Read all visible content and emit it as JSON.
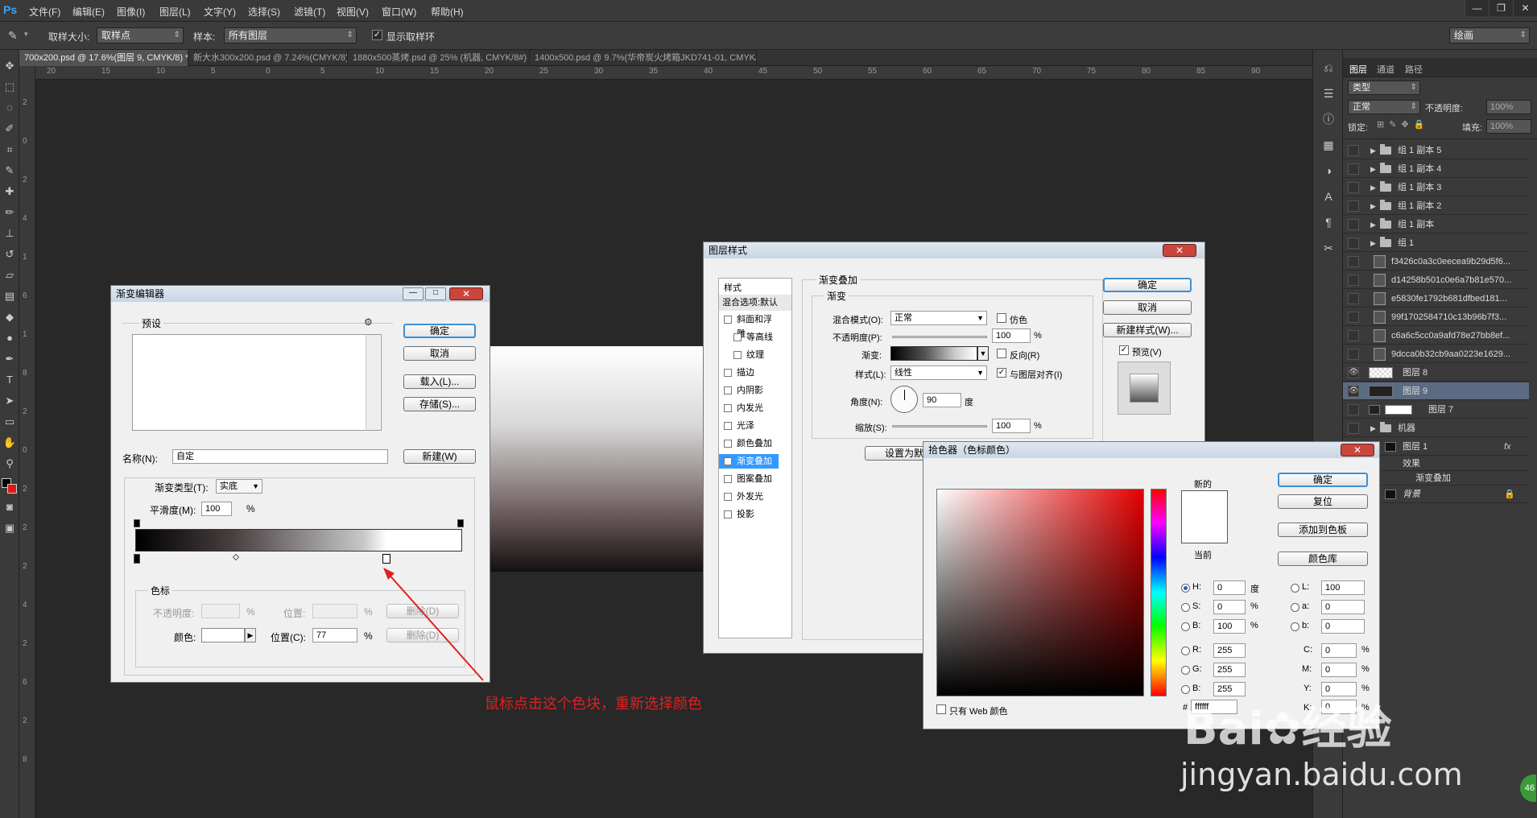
{
  "app": {
    "logo": "Ps"
  },
  "menu": [
    "文件(F)",
    "编辑(E)",
    "图像(I)",
    "图层(L)",
    "文字(Y)",
    "选择(S)",
    "滤镜(T)",
    "视图(V)",
    "窗口(W)",
    "帮助(H)"
  ],
  "window_buttons": [
    "—",
    "❐",
    "✕"
  ],
  "options": {
    "sample_size_label": "取样大小:",
    "sample_size_value": "取样点",
    "sample_label": "样本:",
    "sample_value": "所有图层",
    "show_ring_label": "显示取样环",
    "workspace": "绘画"
  },
  "tabs": [
    "700x200.psd @ 17.6%(图层 9, CMYK/8) *",
    "新大水300x200.psd @ 7.24%(CMYK/8)",
    "1880x500蒸烤.psd @ 25% (机器, CMYK/8#) *",
    "1400x500.psd @ 9.7%(华帝炭火烤箱JKD741-01, CMYK/8)"
  ],
  "hruler": [
    "20",
    "15",
    "10",
    "5",
    "0",
    "5",
    "10",
    "15",
    "20",
    "25",
    "30",
    "35",
    "40",
    "45",
    "50",
    "55",
    "60",
    "65",
    "70",
    "75",
    "80",
    "85",
    "90"
  ],
  "vruler": [
    "2",
    "0",
    "2",
    "4",
    "1",
    "6",
    "1",
    "8",
    "2",
    "0",
    "2",
    "2",
    "2",
    "4",
    "2",
    "6",
    "2",
    "8"
  ],
  "layers_panel": {
    "tabs": [
      "图层",
      "通道",
      "路径"
    ],
    "filter": "类型",
    "blend": "正常",
    "opacity_label": "不透明度:",
    "opacity_value": "100%",
    "lock_label": "锁定:",
    "fill_label": "填充:",
    "fill_value": "100%",
    "layers": [
      {
        "name": "组 1 副本 5",
        "type": "group"
      },
      {
        "name": "组 1 副本 4",
        "type": "group"
      },
      {
        "name": "组 1 副本 3",
        "type": "group"
      },
      {
        "name": "组 1 副本 2",
        "type": "group"
      },
      {
        "name": "组 1 副本",
        "type": "group"
      },
      {
        "name": "组 1",
        "type": "group"
      },
      {
        "name": "f3426c0a3c0eecea9b29d5f6...",
        "type": "smart"
      },
      {
        "name": "d14258b501c0e6a7b81e570...",
        "type": "smart"
      },
      {
        "name": "e5830fe1792b681dfbed181...",
        "type": "smart"
      },
      {
        "name": "99f1702584710c13b96b7f3...",
        "type": "smart"
      },
      {
        "name": "c6a6c5cc0a9afd78e27bb8ef...",
        "type": "smart"
      },
      {
        "name": "9dcca0b32cb9aa0223e1629...",
        "type": "smart"
      },
      {
        "name": "图层 8",
        "type": "layer8"
      },
      {
        "name": "图层 9",
        "type": "layer9"
      },
      {
        "name": "图层 7",
        "type": "layer7"
      },
      {
        "name": "机器",
        "type": "group"
      },
      {
        "name": "图层 1",
        "type": "layer1"
      },
      {
        "name": "效果",
        "type": "effects"
      },
      {
        "name": "渐变叠加",
        "type": "effect"
      },
      {
        "name": "背景",
        "type": "background"
      }
    ],
    "fx": "fx"
  },
  "gradient_editor": {
    "title": "渐变编辑器",
    "presets_label": "预设",
    "ok": "确定",
    "cancel": "取消",
    "load": "载入(L)...",
    "save": "存储(S)...",
    "name_label": "名称(N):",
    "name_value": "自定",
    "new": "新建(W)",
    "type_label": "渐变类型(T):",
    "type_value": "实底",
    "smooth_label": "平滑度(M):",
    "smooth_value": "100",
    "smooth_unit": "%",
    "stops_label": "色标",
    "opacity_label": "不透明度:",
    "pct": "%",
    "location_label": "位置:",
    "delete1": "删除(D)",
    "color_label": "颜色:",
    "location2_label": "位置(C):",
    "location2_value": "77",
    "delete2": "删除(D)"
  },
  "layer_style": {
    "title": "图层样式",
    "list_header": "样式",
    "blend_default": "混合选项:默认",
    "items": [
      {
        "label": "斜面和浮雕",
        "checked": false,
        "indent": false
      },
      {
        "label": "等高线",
        "checked": false,
        "indent": true
      },
      {
        "label": "纹理",
        "checked": false,
        "indent": true
      },
      {
        "label": "描边",
        "checked": false,
        "indent": false
      },
      {
        "label": "内阴影",
        "checked": false,
        "indent": false
      },
      {
        "label": "内发光",
        "checked": false,
        "indent": false
      },
      {
        "label": "光泽",
        "checked": false,
        "indent": false
      },
      {
        "label": "颜色叠加",
        "checked": false,
        "indent": false
      },
      {
        "label": "渐变叠加",
        "checked": true,
        "indent": false
      },
      {
        "label": "图案叠加",
        "checked": false,
        "indent": false
      },
      {
        "label": "外发光",
        "checked": false,
        "indent": false
      },
      {
        "label": "投影",
        "checked": false,
        "indent": false
      }
    ],
    "section_title": "渐变叠加",
    "sub_title": "渐变",
    "blend_label": "混合模式(O):",
    "blend_value": "正常",
    "dither": "仿色",
    "opacity_label": "不透明度(P):",
    "opacity_value": "100",
    "pct": "%",
    "gradient_label": "渐变:",
    "reverse": "反向(R)",
    "style_label": "样式(L):",
    "style_value": "线性",
    "align": "与图层对齐(I)",
    "angle_label": "角度(N):",
    "angle_value": "90",
    "angle_unit": "度",
    "scale_label": "缩放(S):",
    "scale_value": "100",
    "set_default": "设置为默认",
    "ok": "确定",
    "cancel": "取消",
    "new_style": "新建样式(W)...",
    "preview": "预览(V)"
  },
  "color_picker": {
    "title": "拾色器（色标颜色）",
    "new_label": "新的",
    "current_label": "当前",
    "ok": "确定",
    "reset": "复位",
    "add_swatch": "添加到色板",
    "libraries": "颜色库",
    "H": "0",
    "H_unit": "度",
    "S": "0",
    "B": "100",
    "pct": "%",
    "R": "255",
    "G": "255",
    "Bv": "255",
    "L": "100",
    "a": "0",
    "b": "0",
    "C": "0",
    "M": "0",
    "Y": "0",
    "K": "0",
    "hex": "ffffff",
    "web_only": "只有 Web 颜色"
  },
  "annotation": "鼠标点击这个色块，重新选择颜色",
  "watermark": {
    "brand": "Bai",
    "brand2": "经验",
    "url": "jingyan.baidu.com"
  },
  "badge": "46"
}
